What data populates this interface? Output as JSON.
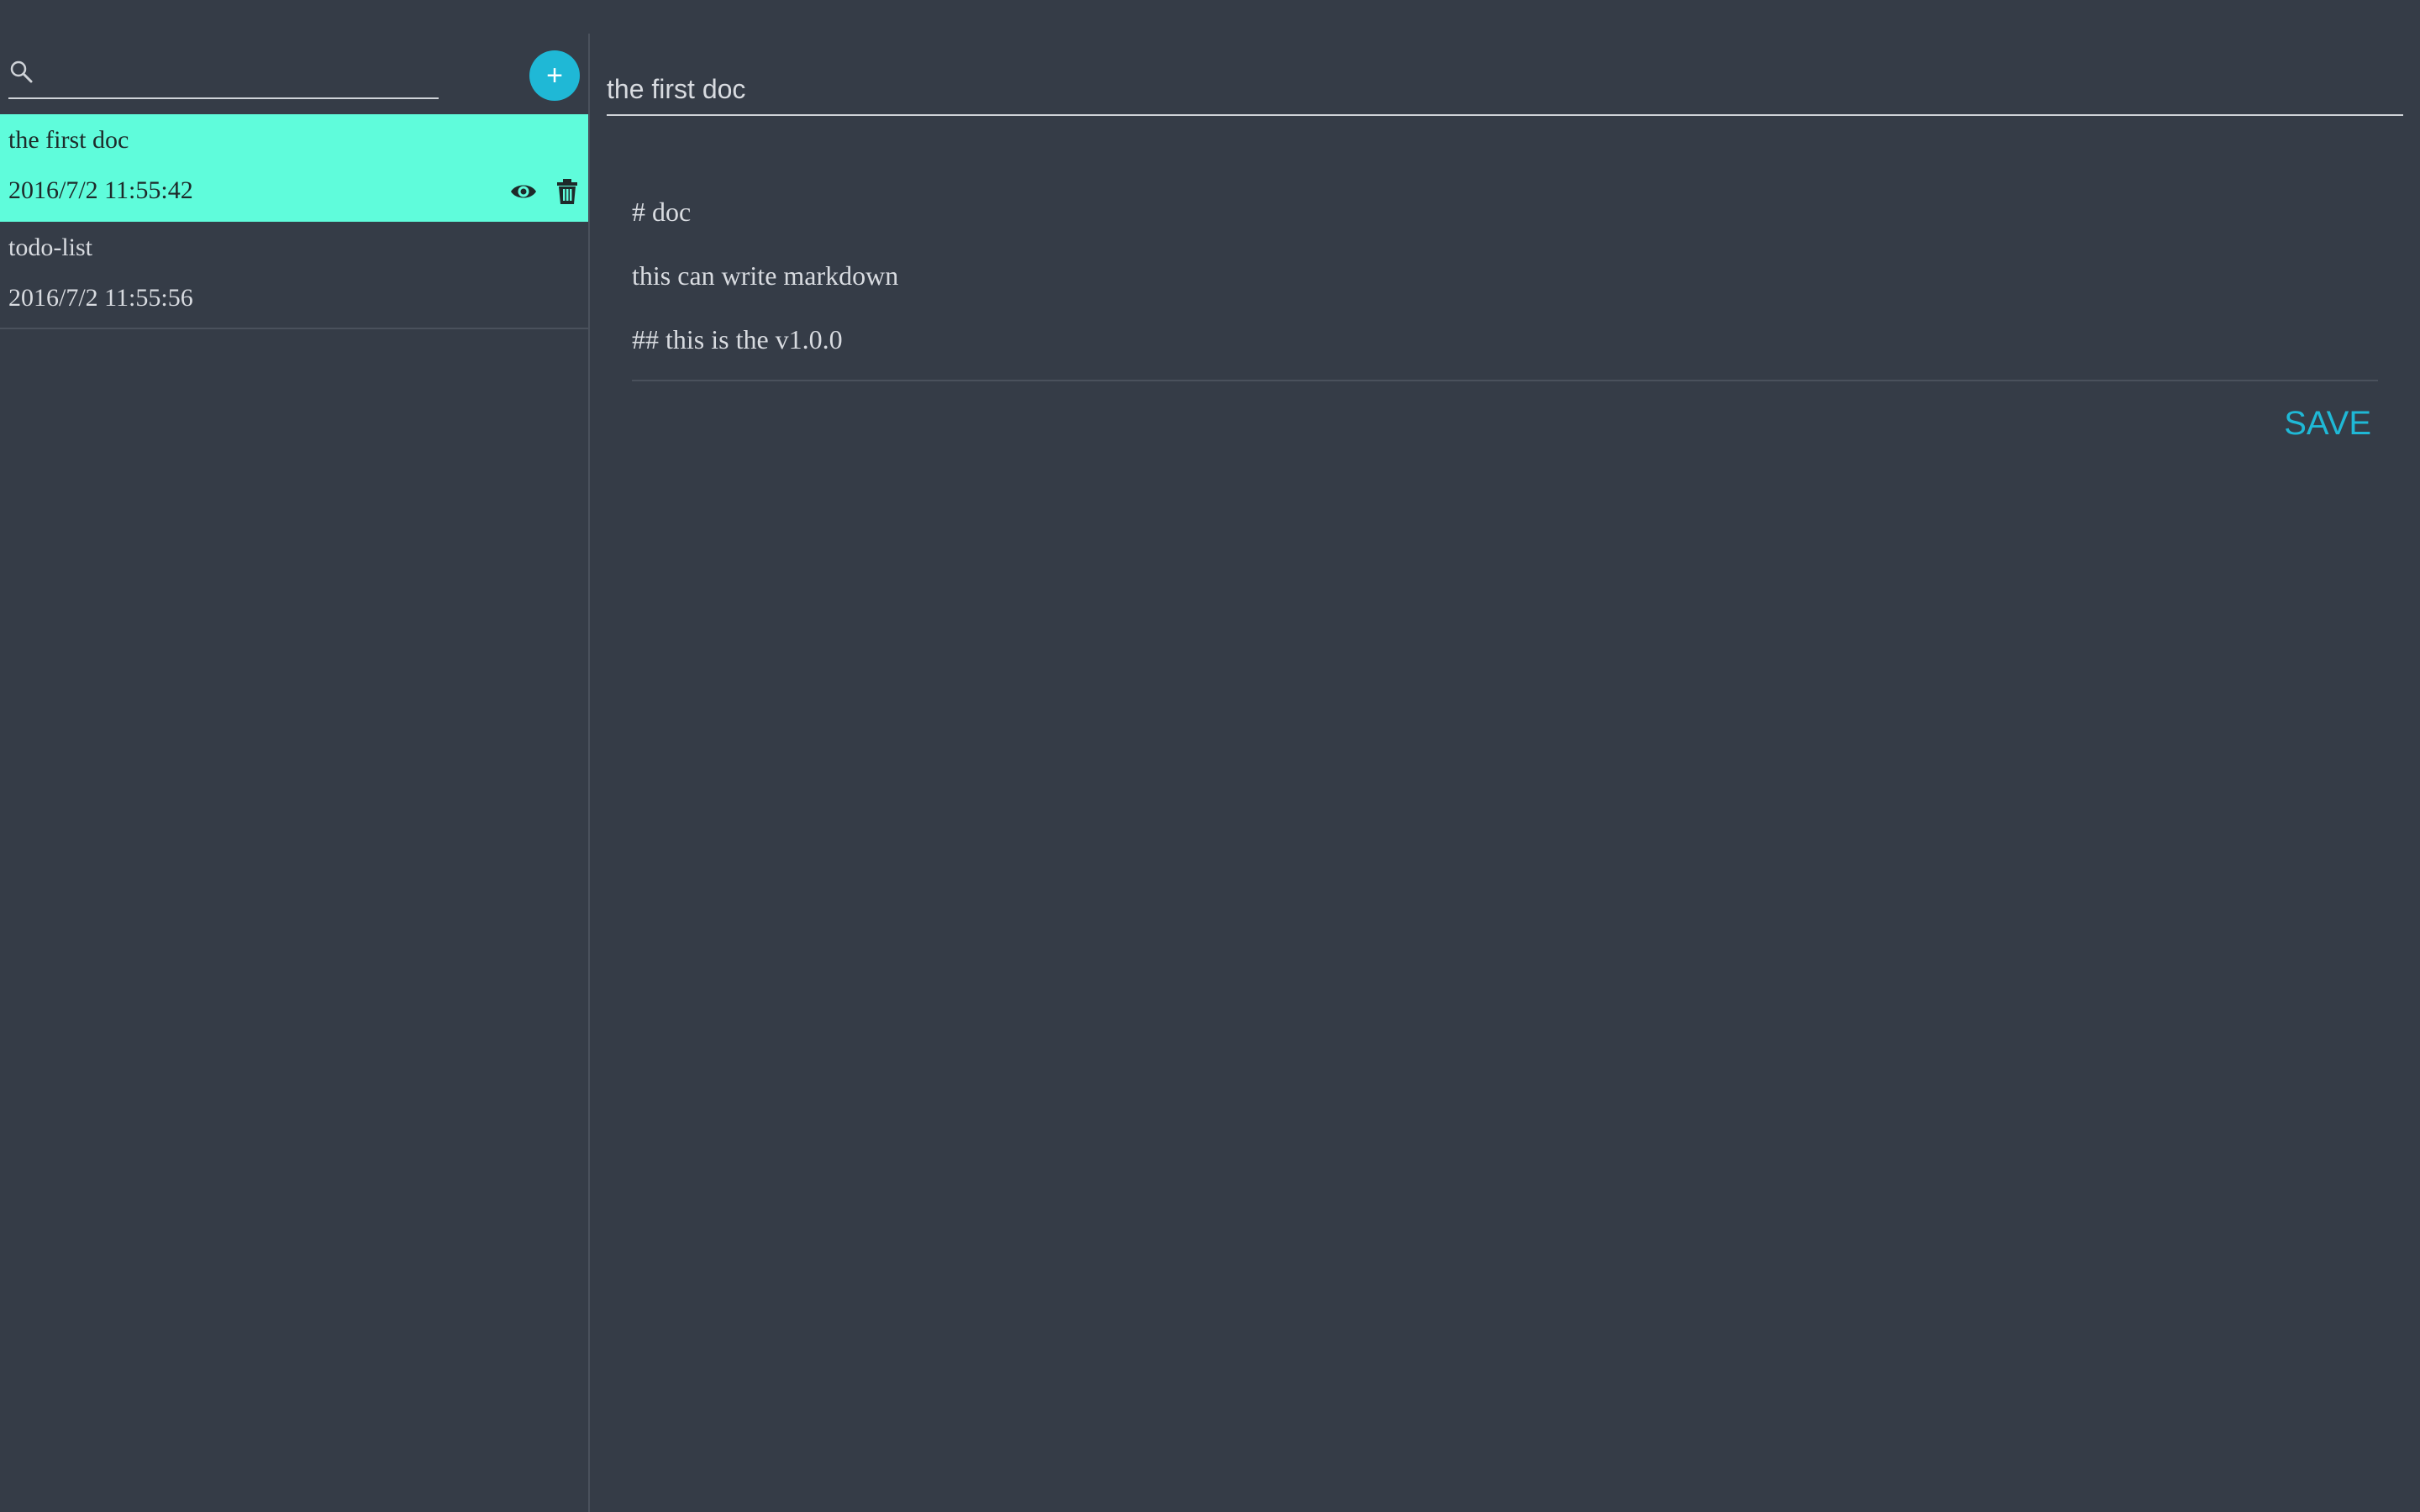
{
  "sidebar": {
    "search": {
      "placeholder": "",
      "value": "",
      "icon": "search-icon"
    },
    "add_button": {
      "label": "+",
      "color": "#1fb8d6"
    },
    "docs": [
      {
        "title": "the first doc",
        "date": "2016/7/2 11:55:42",
        "active": true,
        "actions": [
          "eye-icon",
          "trash-icon"
        ]
      },
      {
        "title": "todo-list",
        "date": "2016/7/2 11:55:56",
        "active": false
      }
    ]
  },
  "editor": {
    "title": "the first doc",
    "content_lines": [
      "# doc",
      "this can write markdown",
      "## this is the v1.0.0"
    ],
    "save_label": "SAVE"
  },
  "colors": {
    "background": "#353c47",
    "active_item": "#5ffcdb",
    "accent": "#1fb8d6",
    "text": "#d8dbe0"
  }
}
